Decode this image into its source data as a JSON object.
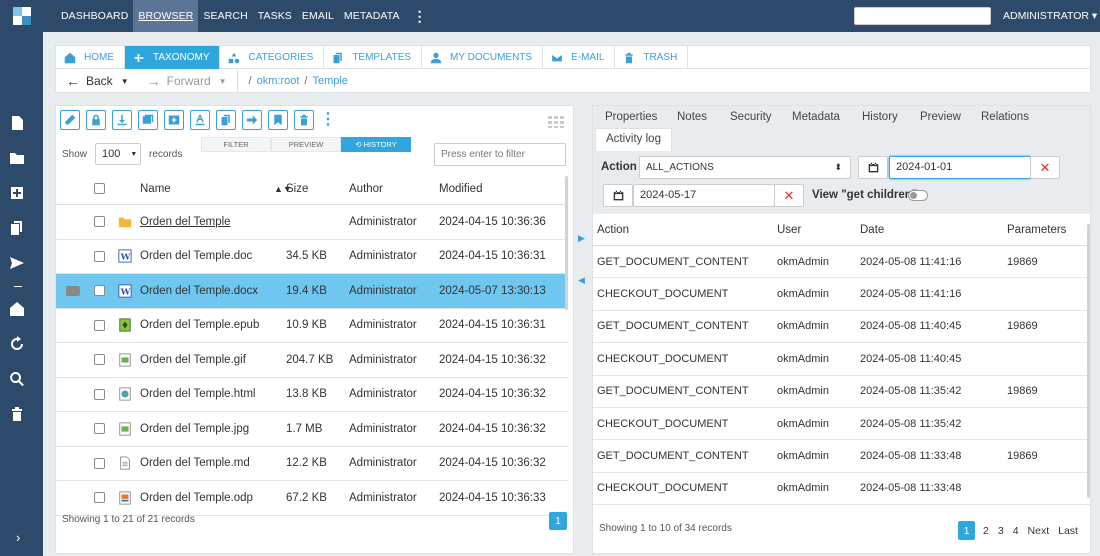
{
  "topnav": {
    "menu": [
      "DASHBOARD",
      "BROWSER",
      "SEARCH",
      "TASKS",
      "EMAIL",
      "METADATA"
    ],
    "active": "BROWSER",
    "user": "ADMINISTRATOR ▾"
  },
  "sidebar_icons": [
    "new-document-icon",
    "new-folder-icon",
    "add-icon",
    "copy-icon",
    "send-icon",
    "home-icon",
    "refresh-icon",
    "search-icon",
    "trash-icon",
    "expand-icon"
  ],
  "tabs": [
    {
      "label": "HOME",
      "icon": "home-icon"
    },
    {
      "label": "TAXONOMY",
      "icon": "taxonomy-icon",
      "active": true
    },
    {
      "label": "CATEGORIES",
      "icon": "categories-icon"
    },
    {
      "label": "TEMPLATES",
      "icon": "templates-icon"
    },
    {
      "label": "MY DOCUMENTS",
      "icon": "user-icon"
    },
    {
      "label": "E-MAIL",
      "icon": "email-icon"
    },
    {
      "label": "TRASH",
      "icon": "trash-icon"
    }
  ],
  "navbar": {
    "back": "Back",
    "forward": "Forward",
    "crumbs": [
      "okm:root",
      "Temple"
    ]
  },
  "file_panel": {
    "show_label": "Show",
    "show_value": "100",
    "records_label": "records",
    "subtabs": [
      "FILTER",
      "PREVIEW",
      "HISTORY"
    ],
    "filter_placeholder": "Press enter to filter",
    "columns": [
      "Name",
      "Size",
      "Author",
      "Modified"
    ],
    "rows": [
      {
        "name": "Orden del Temple",
        "size": "",
        "author": "Administrator",
        "modified": "2024-04-15 10:36:36",
        "type": "folder"
      },
      {
        "name": "Orden del Temple.doc",
        "size": "34.5 KB",
        "author": "Administrator",
        "modified": "2024-04-15 10:36:31",
        "type": "word"
      },
      {
        "name": "Orden del Temple.docx",
        "size": "19.4 KB",
        "author": "Administrator",
        "modified": "2024-05-07 13:30:13",
        "type": "word",
        "selected": true
      },
      {
        "name": "Orden del Temple.epub",
        "size": "10.9 KB",
        "author": "Administrator",
        "modified": "2024-04-15 10:36:31",
        "type": "epub"
      },
      {
        "name": "Orden del Temple.gif",
        "size": "204.7 KB",
        "author": "Administrator",
        "modified": "2024-04-15 10:36:32",
        "type": "image"
      },
      {
        "name": "Orden del Temple.html",
        "size": "13.8 KB",
        "author": "Administrator",
        "modified": "2024-04-15 10:36:32",
        "type": "html"
      },
      {
        "name": "Orden del Temple.jpg",
        "size": "1.7 MB",
        "author": "Administrator",
        "modified": "2024-04-15 10:36:32",
        "type": "image"
      },
      {
        "name": "Orden del Temple.md",
        "size": "12.2 KB",
        "author": "Administrator",
        "modified": "2024-04-15 10:36:32",
        "type": "text"
      },
      {
        "name": "Orden del Temple.odp",
        "size": "67.2 KB",
        "author": "Administrator",
        "modified": "2024-04-15 10:36:33",
        "type": "odp"
      }
    ],
    "footer": "Showing 1 to 21 of 21 records",
    "page": "1"
  },
  "detail_panel": {
    "tabs": [
      "Properties",
      "Notes",
      "Security",
      "Metadata",
      "History",
      "Preview",
      "Relations",
      "Activity log"
    ],
    "active_tab": "Activity log",
    "action_label": "Action",
    "action_value": "ALL_ACTIONS",
    "date_from": "2024-01-01",
    "date_to": "2024-05-17",
    "children_label": "View \"get children\"",
    "columns": [
      "Action",
      "User",
      "Date",
      "Parameters"
    ],
    "rows": [
      {
        "action": "GET_DOCUMENT_CONTENT",
        "user": "okmAdmin",
        "date": "2024-05-08 11:41:16",
        "params": "19869"
      },
      {
        "action": "CHECKOUT_DOCUMENT",
        "user": "okmAdmin",
        "date": "2024-05-08 11:41:16",
        "params": ""
      },
      {
        "action": "GET_DOCUMENT_CONTENT",
        "user": "okmAdmin",
        "date": "2024-05-08 11:40:45",
        "params": "19869"
      },
      {
        "action": "CHECKOUT_DOCUMENT",
        "user": "okmAdmin",
        "date": "2024-05-08 11:40:45",
        "params": ""
      },
      {
        "action": "GET_DOCUMENT_CONTENT",
        "user": "okmAdmin",
        "date": "2024-05-08 11:35:42",
        "params": "19869"
      },
      {
        "action": "CHECKOUT_DOCUMENT",
        "user": "okmAdmin",
        "date": "2024-05-08 11:35:42",
        "params": ""
      },
      {
        "action": "GET_DOCUMENT_CONTENT",
        "user": "okmAdmin",
        "date": "2024-05-08 11:33:48",
        "params": "19869"
      },
      {
        "action": "CHECKOUT_DOCUMENT",
        "user": "okmAdmin",
        "date": "2024-05-08 11:33:48",
        "params": ""
      }
    ],
    "footer": "Showing 1 to 10 of 34 records",
    "pages": [
      "1",
      "2",
      "3",
      "4",
      "Next",
      "Last"
    ]
  },
  "colors": {
    "nav": "#2e4a6b",
    "accent": "#2fa6de",
    "selected_row": "#6fc6ee"
  }
}
